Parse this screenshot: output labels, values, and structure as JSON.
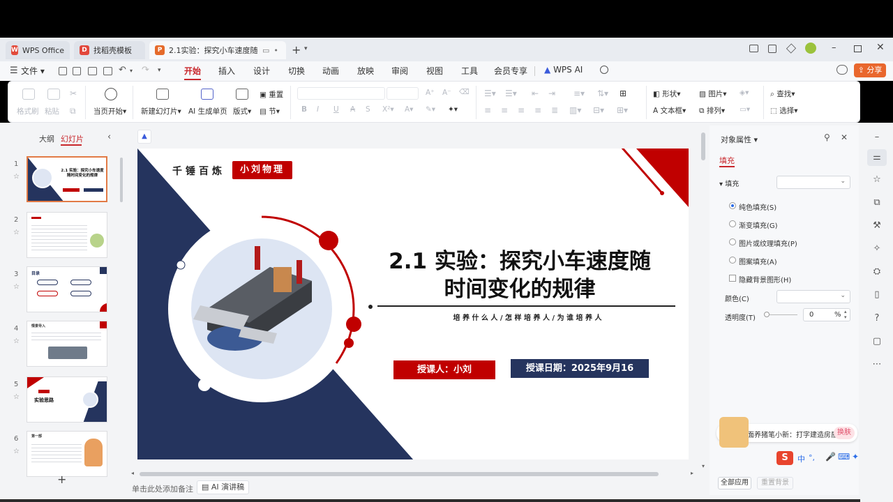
{
  "tabs": [
    {
      "label": "WPS Office"
    },
    {
      "label": "找稻壳模板"
    },
    {
      "label": "2.1实验：探究小车速度随时间"
    }
  ],
  "tab_icons": {
    "wps": "wps-logo-icon",
    "docer": "docer-icon",
    "ppt": "P"
  },
  "menu": {
    "file": "文件",
    "items": [
      "开始",
      "插入",
      "设计",
      "切换",
      "动画",
      "放映",
      "审阅",
      "视图",
      "工具",
      "会员专享"
    ],
    "wps_ai": "WPS AI",
    "share": "分享"
  },
  "ribbon": {
    "format_painter": "格式刷",
    "paste": "粘贴",
    "start_from_current": "当页开始",
    "new_slide": "新建幻灯片",
    "ai_single": "AI 生成单页",
    "layout": "版式",
    "reset": "重置",
    "section": "节",
    "shape": "形状",
    "picture": "图片",
    "find": "查找",
    "textbox": "文本框",
    "arrange": "排列",
    "select": "选择"
  },
  "left_panel": {
    "outline_tab": "大纲",
    "slides_tab": "幻灯片",
    "slide_numbers": [
      "1",
      "2",
      "3",
      "4",
      "5",
      "6"
    ],
    "thumb1_title": "2.1 实验：探究小车速度随时间变化的规律",
    "thumb3_title": "目录",
    "thumb4_title": "情景导入",
    "thumb5_title": "实验思路",
    "thumb6_title": "第一部"
  },
  "slide": {
    "brand_left": "千锤百炼",
    "brand_badge": "小刘物理",
    "title_line1": "2.1 实验：探究小车速度随",
    "title_line2": "时间变化的规律",
    "subtitle": "培 养 什 么 人 / 怎 样 培 养 人 / 为 谁 培 养 人",
    "teacher": "授课人：小刘",
    "date": "授课日期：2025年9月16"
  },
  "notes_placeholder": "单击此处添加备注",
  "ai_speech": "AI 演讲稿",
  "right_panel": {
    "title": "对象属性",
    "tab_fill": "填充",
    "section_fill": "填充",
    "options": [
      "纯色填充(S)",
      "渐变填充(G)",
      "图片或纹理填充(P)",
      "图案填充(A)",
      "隐藏背景图形(H)"
    ],
    "color_label": "颜色(C)",
    "transparency_label": "透明度(T)",
    "transparency_value": "0",
    "transparency_unit": "%",
    "notice_text": "桌面养猪笔小新：打字建造房屋",
    "notice_button": "换肤",
    "ime_text": "中",
    "footer_all_apply": "全部应用",
    "footer_reset_bg": "重置背景"
  },
  "colors": {
    "accent_red": "#c8262b",
    "navy": "#25345e",
    "brand_red": "#c00000"
  }
}
